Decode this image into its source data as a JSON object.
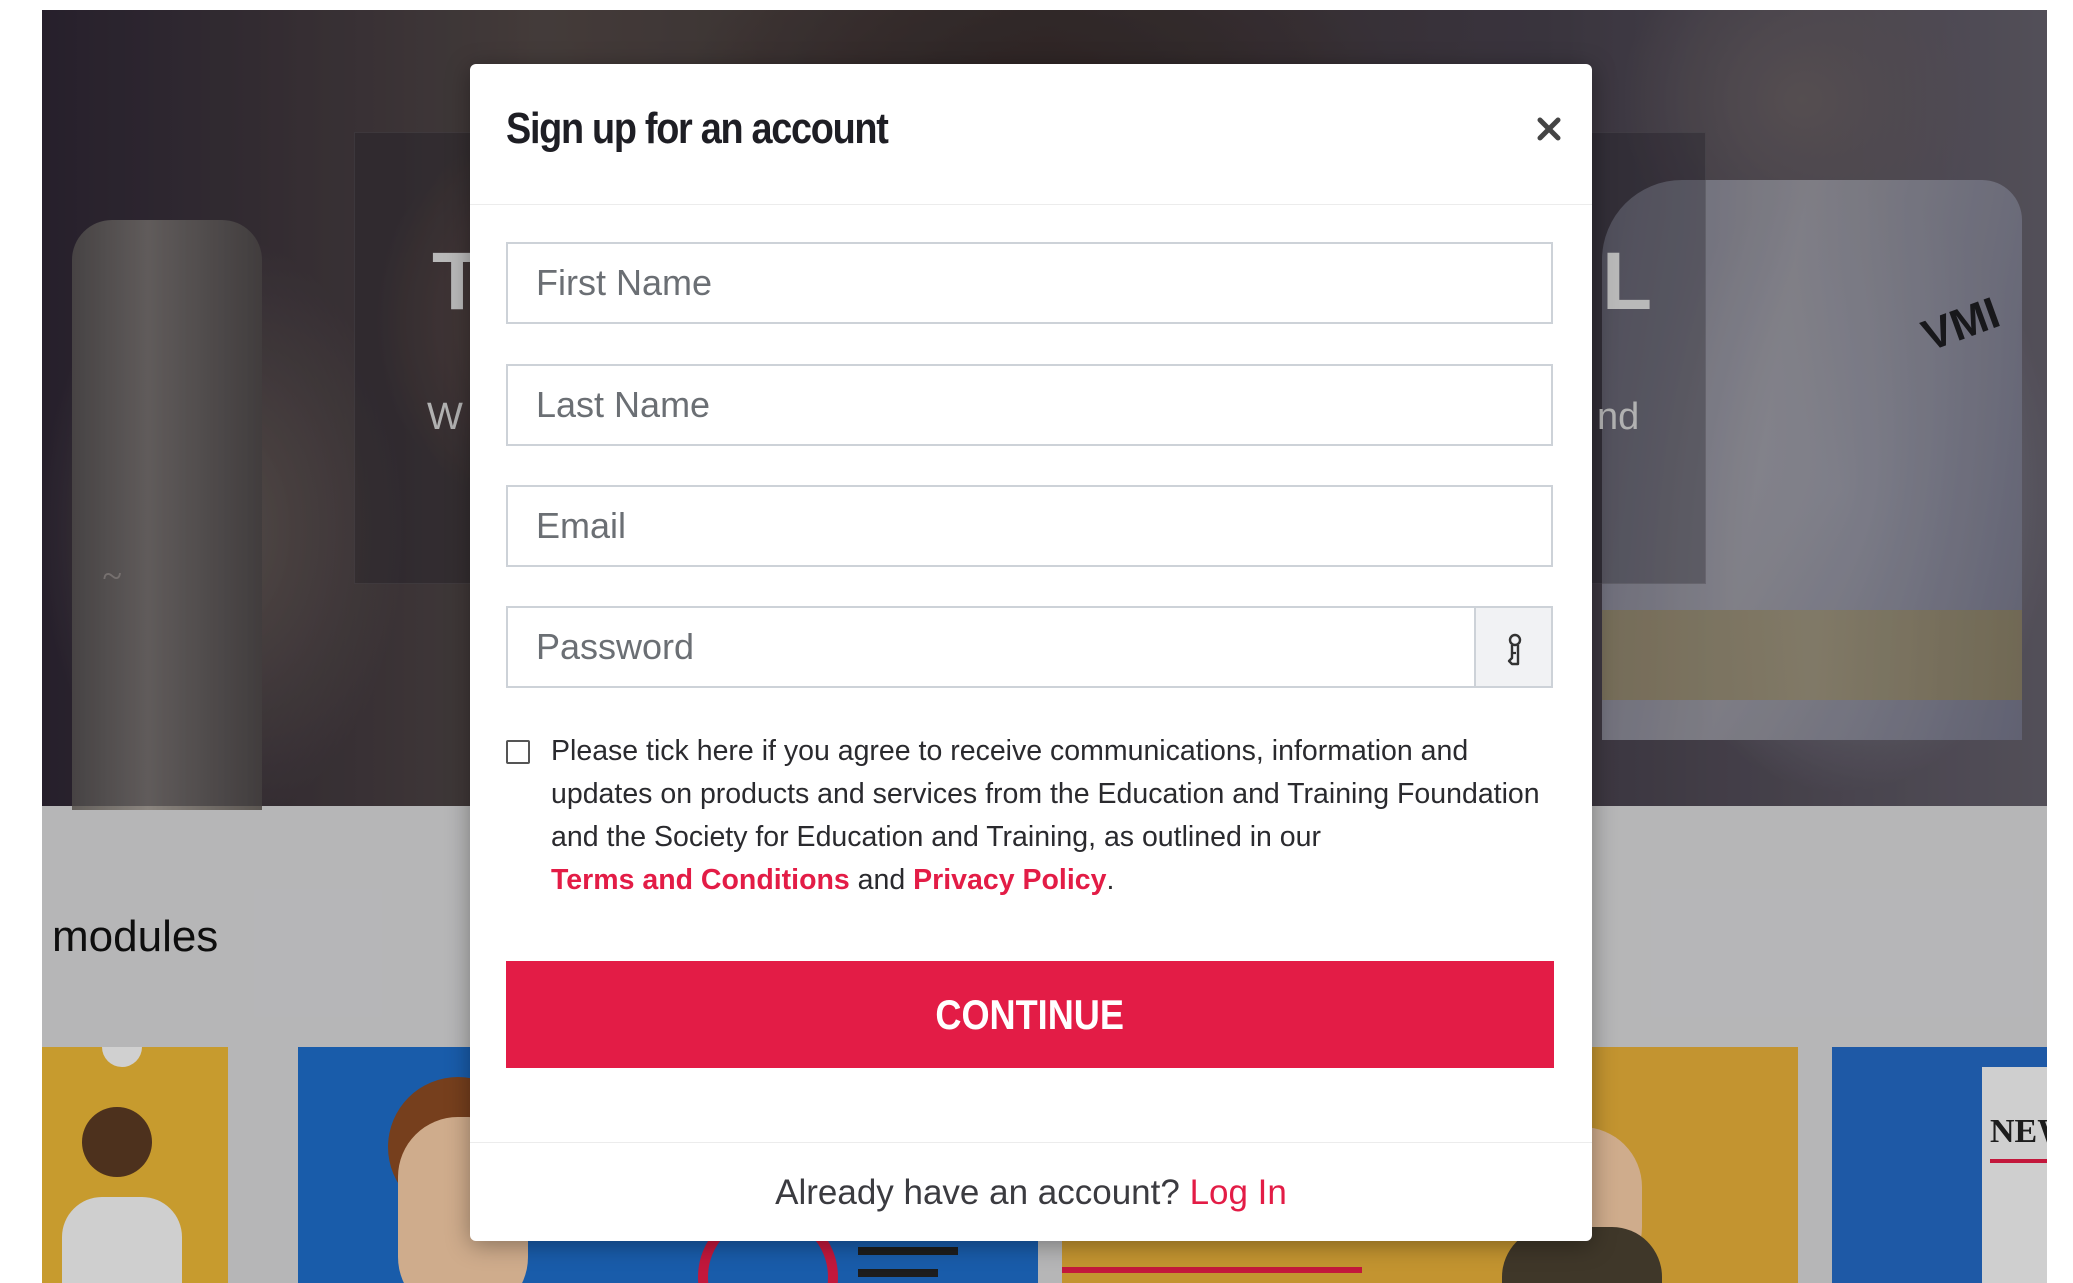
{
  "background": {
    "hero_title_left": "T",
    "hero_title_right": "L",
    "hero_sub_left": "W",
    "hero_sub_right": "nd",
    "hero_vest_text": "VMI",
    "modules_heading": "modules",
    "news_card_text": "NEW"
  },
  "modal": {
    "title": "Sign up for an account",
    "close_icon": "close-icon",
    "fields": {
      "first_name_placeholder": "First Name",
      "last_name_placeholder": "Last Name",
      "email_placeholder": "Email",
      "password_placeholder": "Password",
      "password_toggle_icon": "key-icon"
    },
    "consent": {
      "checked": false,
      "line1": "Please tick here if you agree to receive communications, information and",
      "line2": "updates on products and services from the Education and Training Foundation",
      "line3": "and the Society for Education and Training, as outlined in our",
      "terms_link": "Terms and Conditions",
      "and_word": " and ",
      "privacy_link": "Privacy Policy",
      "period": "."
    },
    "continue_label": "CONTINUE",
    "footer": {
      "prompt": "Already have an account? ",
      "login_link": "Log In"
    }
  },
  "colors": {
    "accent": "#e31c46",
    "field_border": "#cdd2d8",
    "title_text": "#1e1e24"
  }
}
